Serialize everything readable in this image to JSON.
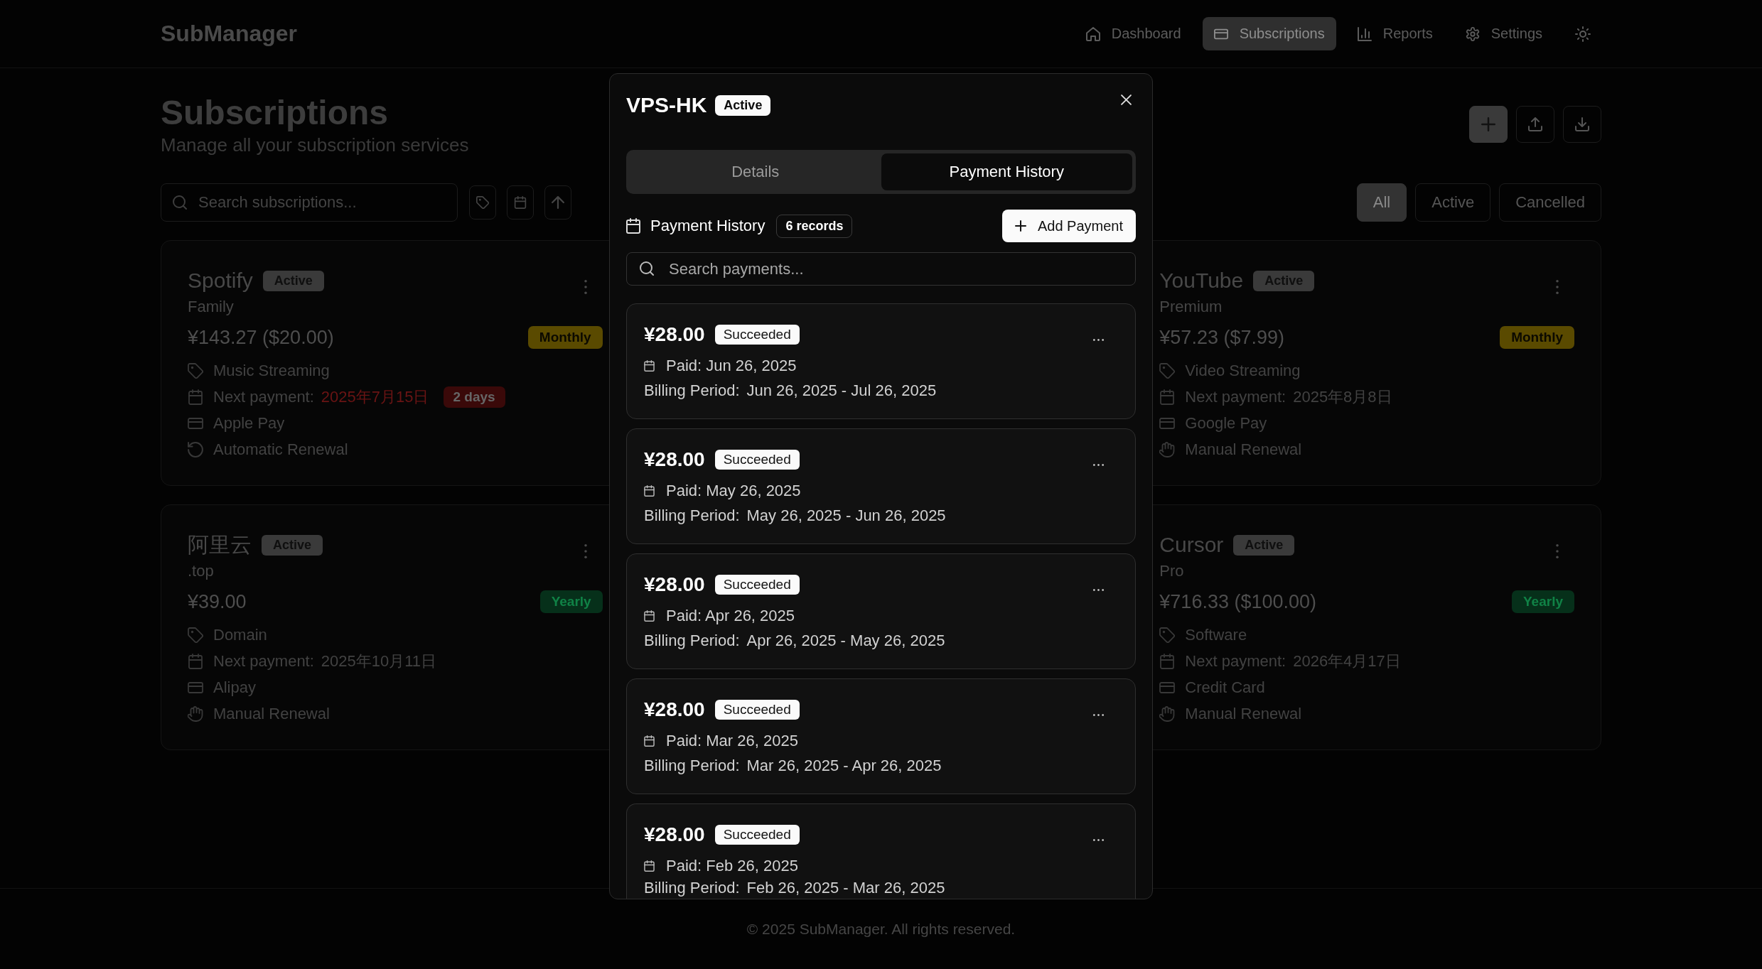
{
  "header": {
    "logo": "SubManager",
    "nav": [
      {
        "label": "Dashboard",
        "selected": false
      },
      {
        "label": "Subscriptions",
        "selected": true
      },
      {
        "label": "Reports",
        "selected": false
      },
      {
        "label": "Settings",
        "selected": false
      }
    ]
  },
  "page": {
    "title": "Subscriptions",
    "subtitle": "Manage all your subscription services"
  },
  "toolbar": {
    "search": {
      "placeholder": "Search subscriptions..."
    },
    "filters": [
      {
        "label": "All",
        "selected": true
      },
      {
        "label": "Active",
        "selected": false
      },
      {
        "label": "Cancelled",
        "selected": false
      }
    ]
  },
  "cards": [
    {
      "name": "Spotify",
      "status": "Active",
      "plan": "Family",
      "price": "¥143.27 ($20.00)",
      "cycle": {
        "label": "Monthly",
        "color": "#5a4a00"
      },
      "category": "Music Streaming",
      "next_payment": {
        "label": "Next payment:",
        "date": "2025年7月15日",
        "due_soon": true,
        "countdown": "2 days"
      },
      "payment_method": "Apple Pay",
      "renewal": {
        "label": "Automatic Renewal",
        "automatic": true
      }
    },
    {
      "name": "YouTube",
      "status": "Active",
      "plan": "Premium",
      "price": "¥57.23 ($7.99)",
      "cycle": {
        "label": "Monthly",
        "color": "#5a4a00"
      },
      "category": "Video Streaming",
      "next_payment": {
        "label": "Next payment:",
        "date": "2025年8月8日",
        "due_soon": false
      },
      "payment_method": "Google Pay",
      "renewal": {
        "label": "Manual Renewal",
        "automatic": false
      }
    },
    {
      "name": "阿里云",
      "status": "Active",
      "plan": ".top",
      "price": "¥39.00",
      "cycle": {
        "label": "Yearly",
        "color": "#06301a"
      },
      "category": "Domain",
      "next_payment": {
        "label": "Next payment:",
        "date": "2025年10月11日",
        "due_soon": false
      },
      "payment_method": "Alipay",
      "renewal": {
        "label": "Manual Renewal",
        "automatic": false
      }
    },
    {
      "name": "Cursor",
      "status": "Active",
      "plan": "Pro",
      "price": "¥716.33 ($100.00)",
      "cycle": {
        "label": "Yearly",
        "color": "#06301a"
      },
      "category": "Software",
      "next_payment": {
        "label": "Next payment:",
        "date": "2026年4月17日",
        "due_soon": false
      },
      "payment_method": "Credit Card",
      "renewal": {
        "label": "Manual Renewal",
        "automatic": false
      }
    }
  ],
  "modal": {
    "title": "VPS-HK",
    "status": "Active",
    "tabs": [
      {
        "label": "Details",
        "selected": false
      },
      {
        "label": "Payment History",
        "selected": true
      }
    ],
    "section": {
      "title": "Payment History",
      "count": "6 records"
    },
    "add_button": "Add Payment",
    "search": {
      "placeholder": "Search payments..."
    },
    "payments": [
      {
        "amount": "¥28.00",
        "status": "Succeeded",
        "paid": "Paid: Jun 26, 2025",
        "period_label": "Billing Period:",
        "period": "Jun 26, 2025 - Jul 26, 2025"
      },
      {
        "amount": "¥28.00",
        "status": "Succeeded",
        "paid": "Paid: May 26, 2025",
        "period_label": "Billing Period:",
        "period": "May 26, 2025 - Jun 26, 2025"
      },
      {
        "amount": "¥28.00",
        "status": "Succeeded",
        "paid": "Paid: Apr 26, 2025",
        "period_label": "Billing Period:",
        "period": "Apr 26, 2025 - May 26, 2025"
      },
      {
        "amount": "¥28.00",
        "status": "Succeeded",
        "paid": "Paid: Mar 26, 2025",
        "period_label": "Billing Period:",
        "period": "Mar 26, 2025 - Apr 26, 2025"
      },
      {
        "amount": "¥28.00",
        "status": "Succeeded",
        "paid": "Paid: Feb 26, 2025",
        "period_label": "Billing Period:",
        "period": "Feb 26, 2025 - Mar 26, 2025"
      }
    ]
  },
  "footer": "© 2025 SubManager. All rights reserved."
}
